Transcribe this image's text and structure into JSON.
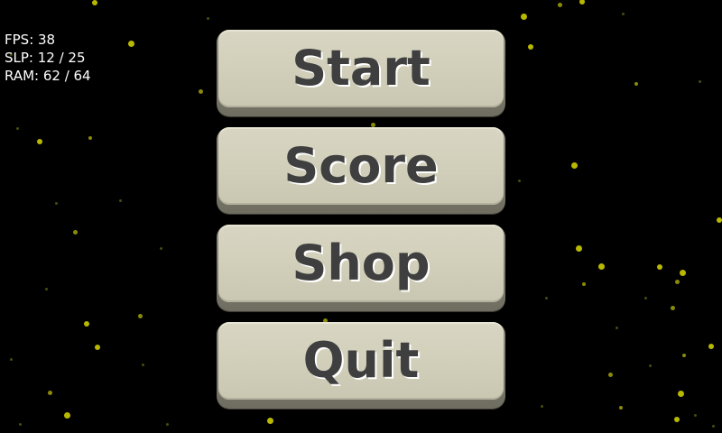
{
  "debug": {
    "fps": "FPS: 38",
    "slp": "SLP: 12 / 25",
    "ram": "RAM: 62 / 64"
  },
  "menu": {
    "start_label": "Start",
    "score_label": "Score",
    "shop_label": "Shop",
    "quit_label": "Quit"
  },
  "colors": {
    "background": "#000000",
    "star": "#b8b800",
    "button_face": "#d3d1bc",
    "button_text": "#3f3f3f",
    "debug_text": "#ffffff"
  }
}
